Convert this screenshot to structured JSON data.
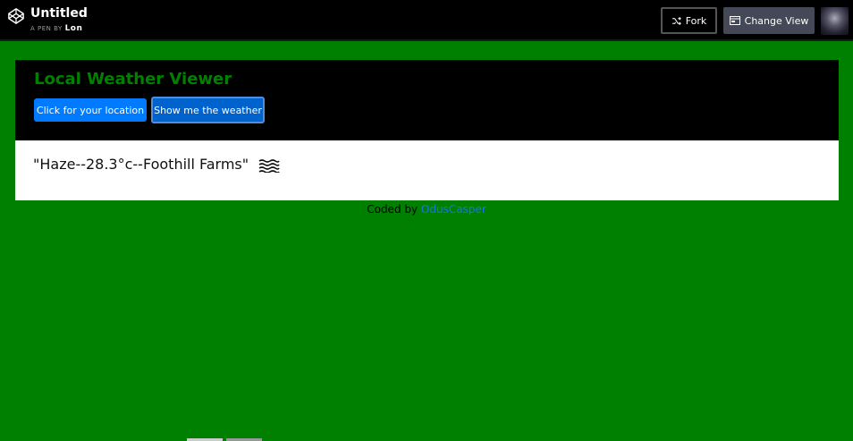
{
  "header": {
    "title": "Untitled",
    "byline_prefix": "A PEN BY",
    "author": "Lon",
    "fork_label": "Fork",
    "change_view_label": "Change View"
  },
  "app": {
    "title": "Local Weather Viewer",
    "location_button": "Click for your location",
    "weather_button": "Show me the weather",
    "weather_text": "\"Haze--28.3°c--Foothill Farms\"",
    "weather_icon": "haze-icon"
  },
  "footer": {
    "prefix": "Coded by",
    "author_link": "OdusCasper"
  },
  "colors": {
    "background": "#008000",
    "title_green": "#008000",
    "button_blue": "#007bff"
  }
}
